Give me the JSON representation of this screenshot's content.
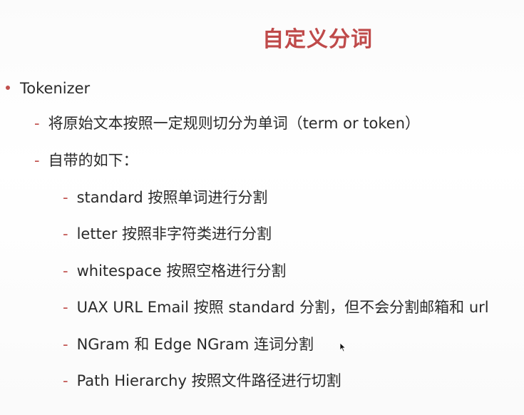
{
  "slide": {
    "title": "自定义分词",
    "bullets": [
      {
        "text": "Tokenizer"
      }
    ],
    "sub_items": [
      {
        "text": "将原始文本按照一定规则切分为单词（term or token）"
      },
      {
        "text": "自带的如下："
      }
    ],
    "tokenizers": [
      {
        "text": "standard 按照单词进行分割"
      },
      {
        "text": "letter 按照非字符类进行分割"
      },
      {
        "text": "whitespace 按照空格进行分割"
      },
      {
        "text": "UAX URL Email 按照 standard 分割，但不会分割邮箱和 url"
      },
      {
        "text": "NGram 和 Edge NGram 连词分割"
      },
      {
        "text": "Path Hierarchy 按照文件路径进行切割"
      }
    ]
  },
  "colors": {
    "accent": "#c0504d",
    "title": "#bf4a4a",
    "text": "#2a2a2a"
  },
  "icons": {
    "cursor": "mouse-pointer-icon"
  }
}
